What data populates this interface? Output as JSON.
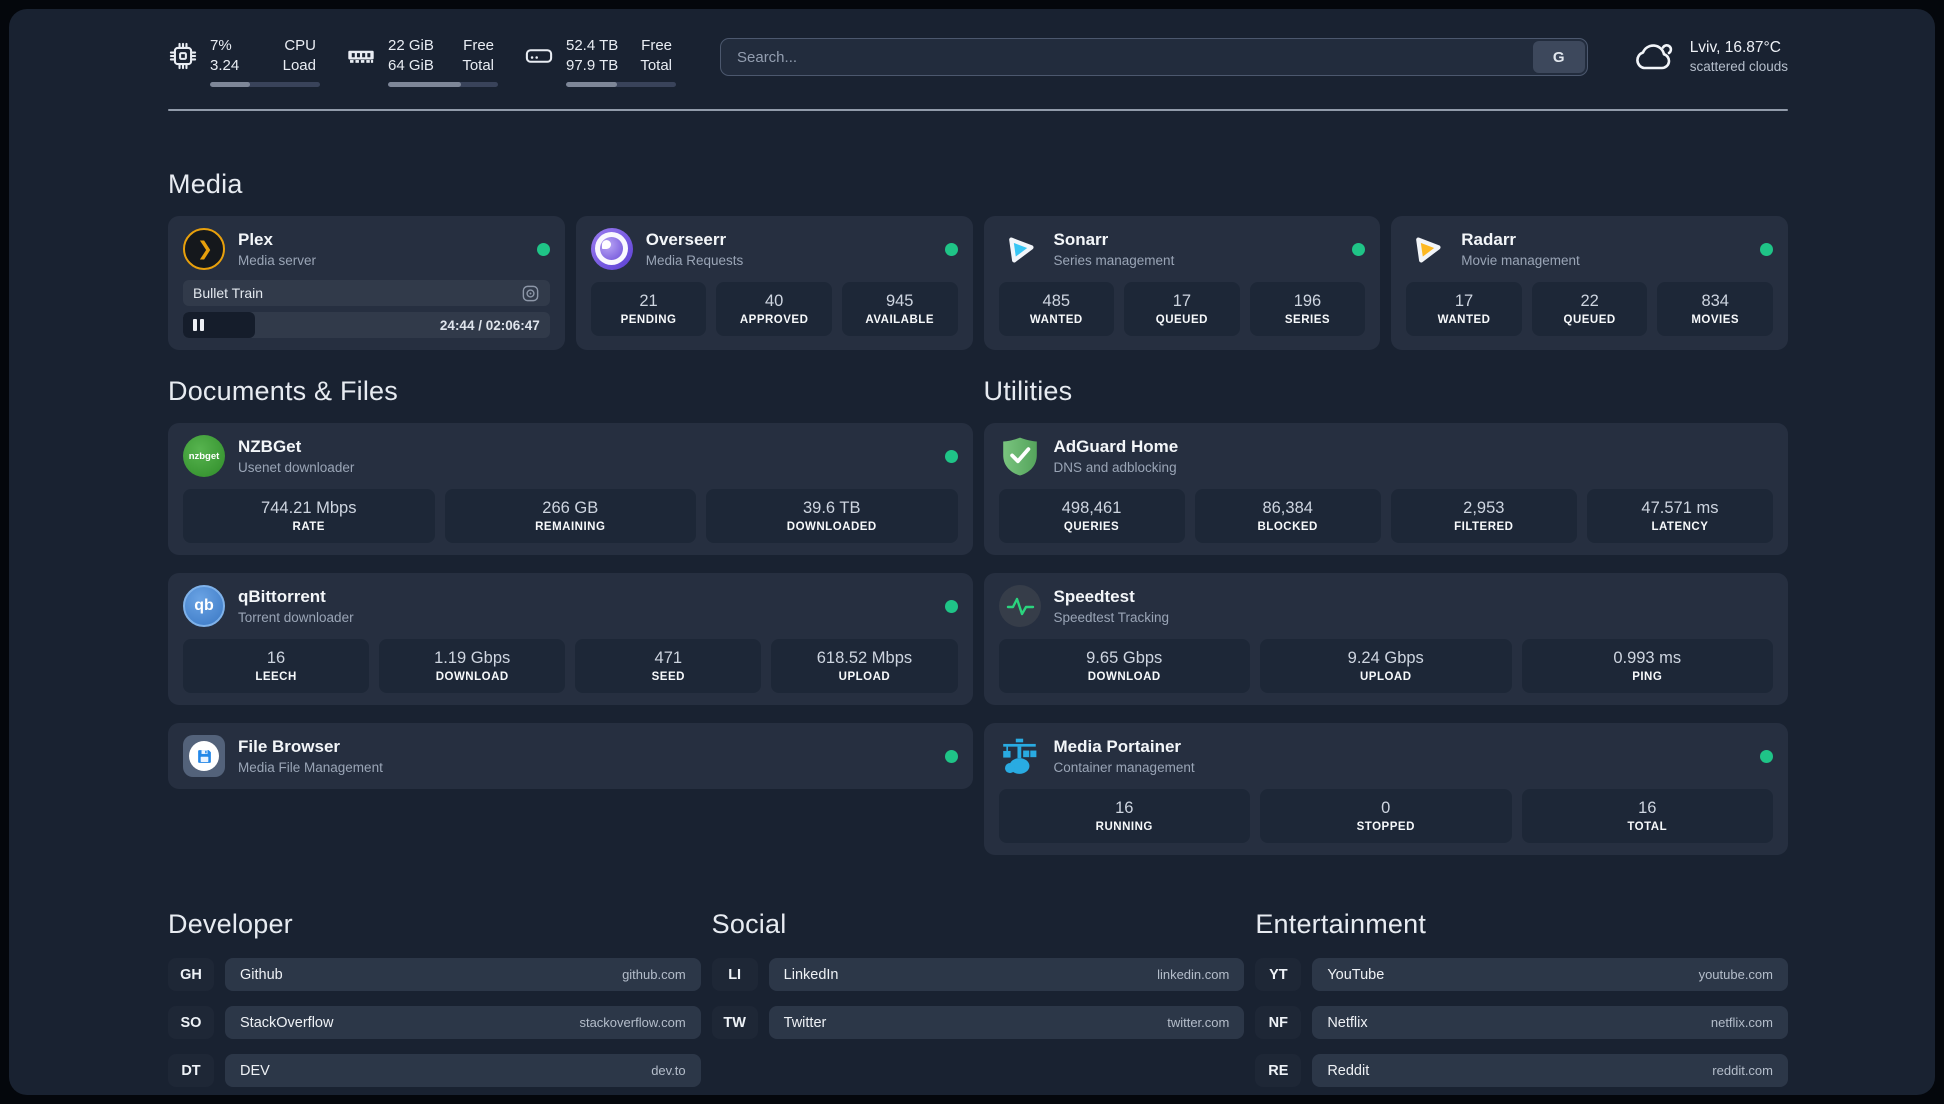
{
  "system": {
    "stats": [
      {
        "icon": "cpu-icon",
        "value_top": "7%",
        "value_bottom": "3.24",
        "label_top": "CPU",
        "label_bottom": "Load",
        "progress_pct": 36
      },
      {
        "icon": "memory-icon",
        "value_top": "22 GiB",
        "value_bottom": "64 GiB",
        "label_top": "Free",
        "label_bottom": "Total",
        "progress_pct": 66
      },
      {
        "icon": "disk-icon",
        "value_top": "52.4 TB",
        "value_bottom": "97.9 TB",
        "label_top": "Free",
        "label_bottom": "Total",
        "progress_pct": 46
      }
    ]
  },
  "search": {
    "placeholder": "Search...",
    "provider_button": "G"
  },
  "weather": {
    "icon": "cloud-icon",
    "title": "Lviv, 16.87°C",
    "subtitle": "scattered clouds"
  },
  "sections": {
    "media": {
      "title": "Media",
      "services": [
        {
          "name": "Plex",
          "description": "Media server",
          "icon": "plex-icon",
          "icon_text": "❯",
          "status": "online",
          "now_playing": {
            "title": "Bullet Train",
            "state": "paused",
            "time": "24:44 / 02:06:47",
            "progress_pct": 19.5
          }
        },
        {
          "name": "Overseerr",
          "description": "Media Requests",
          "icon": "overseerr-icon",
          "status": "online",
          "stats": [
            {
              "value": "21",
              "label": "PENDING"
            },
            {
              "value": "40",
              "label": "APPROVED"
            },
            {
              "value": "945",
              "label": "AVAILABLE"
            }
          ]
        },
        {
          "name": "Sonarr",
          "description": "Series management",
          "icon": "sonarr-icon",
          "status": "online",
          "stats": [
            {
              "value": "485",
              "label": "WANTED"
            },
            {
              "value": "17",
              "label": "QUEUED"
            },
            {
              "value": "196",
              "label": "SERIES"
            }
          ]
        },
        {
          "name": "Radarr",
          "description": "Movie management",
          "icon": "radarr-icon",
          "status": "online",
          "stats": [
            {
              "value": "17",
              "label": "WANTED"
            },
            {
              "value": "22",
              "label": "QUEUED"
            },
            {
              "value": "834",
              "label": "MOVIES"
            }
          ]
        }
      ]
    },
    "documents": {
      "title": "Documents & Files",
      "services": [
        {
          "name": "NZBGet",
          "description": "Usenet downloader",
          "icon": "nzbget-icon",
          "icon_text": "nzbget",
          "status": "online",
          "stats": [
            {
              "value": "744.21 Mbps",
              "label": "RATE"
            },
            {
              "value": "266 GB",
              "label": "REMAINING"
            },
            {
              "value": "39.6 TB",
              "label": "DOWNLOADED"
            }
          ]
        },
        {
          "name": "qBittorrent",
          "description": "Torrent downloader",
          "icon": "qbittorrent-icon",
          "icon_text": "qb",
          "status": "online",
          "stats": [
            {
              "value": "16",
              "label": "LEECH"
            },
            {
              "value": "1.19 Gbps",
              "label": "DOWNLOAD"
            },
            {
              "value": "471",
              "label": "SEED"
            },
            {
              "value": "618.52 Mbps",
              "label": "UPLOAD"
            }
          ]
        },
        {
          "name": "File Browser",
          "description": "Media File Management",
          "icon": "filebrowser-icon",
          "status": "online"
        }
      ]
    },
    "utilities": {
      "title": "Utilities",
      "services": [
        {
          "name": "AdGuard Home",
          "description": "DNS and adblocking",
          "icon": "adguard-icon",
          "stats": [
            {
              "value": "498,461",
              "label": "QUERIES"
            },
            {
              "value": "86,384",
              "label": "BLOCKED"
            },
            {
              "value": "2,953",
              "label": "FILTERED"
            },
            {
              "value": "47.571 ms",
              "label": "LATENCY"
            }
          ]
        },
        {
          "name": "Speedtest",
          "description": "Speedtest Tracking",
          "icon": "speedtest-icon",
          "stats": [
            {
              "value": "9.65 Gbps",
              "label": "DOWNLOAD"
            },
            {
              "value": "9.24 Gbps",
              "label": "UPLOAD"
            },
            {
              "value": "0.993 ms",
              "label": "PING"
            }
          ]
        },
        {
          "name": "Media Portainer",
          "description": "Container management",
          "icon": "portainer-icon",
          "status": "online",
          "stats": [
            {
              "value": "16",
              "label": "RUNNING"
            },
            {
              "value": "0",
              "label": "STOPPED"
            },
            {
              "value": "16",
              "label": "TOTAL"
            }
          ]
        }
      ]
    }
  },
  "bookmarks": {
    "developer": {
      "title": "Developer",
      "items": [
        {
          "abbr": "GH",
          "name": "Github",
          "domain": "github.com"
        },
        {
          "abbr": "SO",
          "name": "StackOverflow",
          "domain": "stackoverflow.com"
        },
        {
          "abbr": "DT",
          "name": "DEV",
          "domain": "dev.to"
        }
      ]
    },
    "social": {
      "title": "Social",
      "items": [
        {
          "abbr": "LI",
          "name": "LinkedIn",
          "domain": "linkedin.com"
        },
        {
          "abbr": "TW",
          "name": "Twitter",
          "domain": "twitter.com"
        }
      ]
    },
    "entertainment": {
      "title": "Entertainment",
      "items": [
        {
          "abbr": "YT",
          "name": "YouTube",
          "domain": "youtube.com"
        },
        {
          "abbr": "NF",
          "name": "Netflix",
          "domain": "netflix.com"
        },
        {
          "abbr": "RE",
          "name": "Reddit",
          "domain": "reddit.com"
        }
      ]
    }
  },
  "colors": {
    "status_online": "#1fc487",
    "page_bg": "#192231",
    "card_bg": "#262f40",
    "stat_bg": "#1d2737",
    "plex": "#e8a00c",
    "overseerr": "#7b5bd6",
    "sonarr": "#38c6f4",
    "radarr": "#fdb924",
    "nzbget": "#3f9e3a",
    "qbittorrent": "#4889d6",
    "adguard": "#63b168",
    "speedtest": "#2bd47e",
    "filebrowser": "#2488e8",
    "portainer": "#29abe2"
  }
}
